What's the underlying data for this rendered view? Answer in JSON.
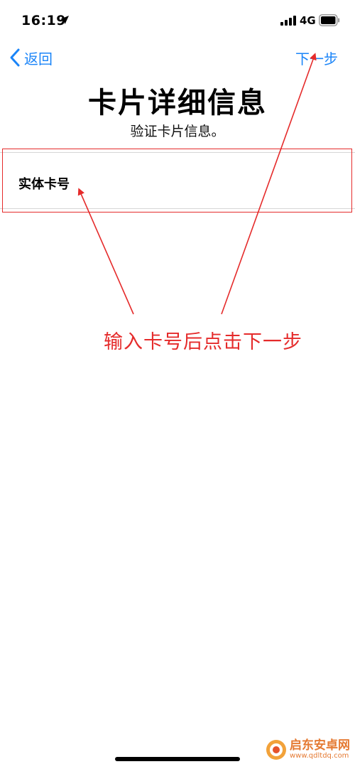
{
  "status_bar": {
    "time": "16:19",
    "network": "4G"
  },
  "nav": {
    "back_label": "返回",
    "next_label": "下一步"
  },
  "header": {
    "title": "卡片详细信息",
    "subtitle": "验证卡片信息。"
  },
  "form": {
    "card_number_label": "实体卡号",
    "card_number_value": "",
    "card_number_placeholder": ""
  },
  "annotation": {
    "text": "输入卡号后点击下一步",
    "color": "#e52b2b"
  },
  "watermark": {
    "name": "启东安卓网",
    "url": "www.qdltdq.com"
  },
  "colors": {
    "accent": "#1a84f8",
    "annotation": "#e52b2b"
  }
}
